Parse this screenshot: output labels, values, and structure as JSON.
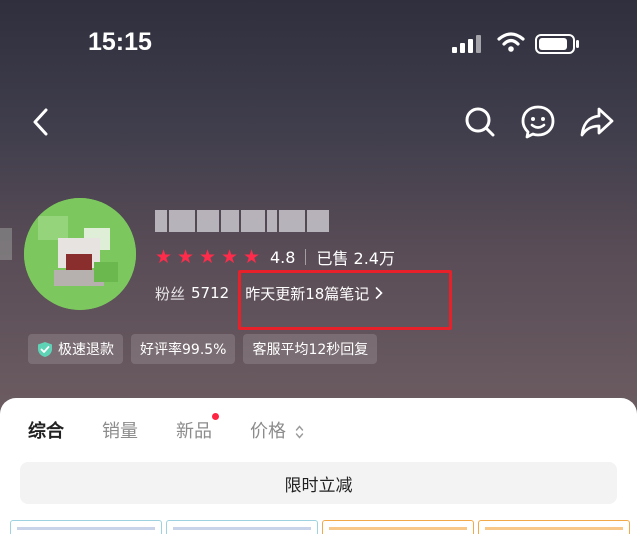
{
  "status_bar": {
    "time": "15:15"
  },
  "store": {
    "rating": "4.8",
    "sold": "已售 2.4万",
    "fans_label": "粉丝",
    "fans_count": "5712",
    "notes_update": "昨天更新18篇笔记"
  },
  "badges": [
    {
      "label": "极速退款",
      "icon": "shield-check-icon"
    },
    {
      "label": "好评率99.5%"
    },
    {
      "label": "客服平均12秒回复"
    }
  ],
  "tabs": [
    {
      "label": "综合",
      "active": true
    },
    {
      "label": "销量"
    },
    {
      "label": "新品"
    },
    {
      "label": "价格"
    }
  ],
  "flash_sale_label": "限时立减",
  "colors": {
    "star": "#ff2b4a",
    "highlight_box": "#e8202a",
    "red_dot": "#ff2442"
  }
}
